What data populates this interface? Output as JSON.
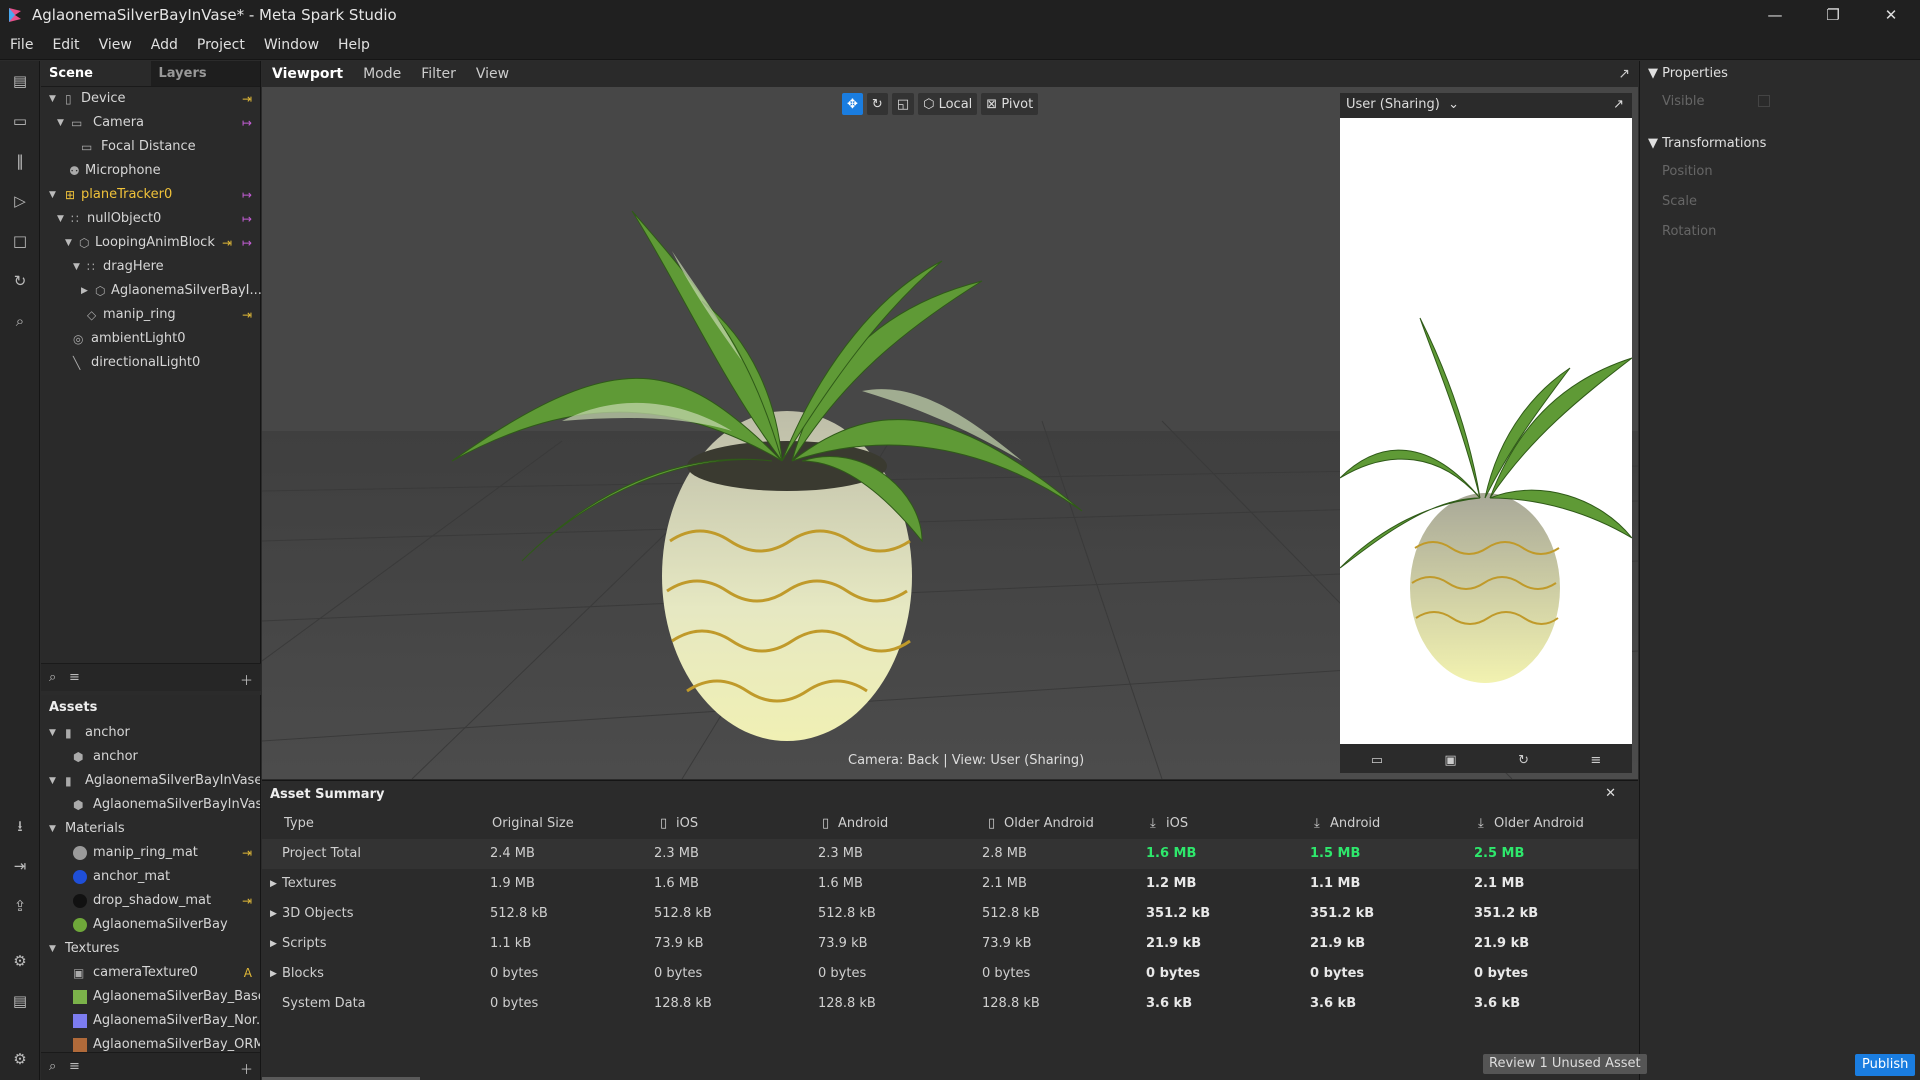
{
  "window": {
    "title": "AglaonemaSilverBayInVase* - Meta Spark Studio",
    "controls": [
      "minimize",
      "restore",
      "close"
    ]
  },
  "menu": [
    "File",
    "Edit",
    "View",
    "Add",
    "Project",
    "Window",
    "Help"
  ],
  "scene": {
    "tabs": [
      "Scene",
      "Layers"
    ],
    "items": [
      {
        "label": "Device",
        "icon": "device-icon"
      },
      {
        "label": "Camera",
        "icon": "camera-icon"
      },
      {
        "label": "Focal Distance",
        "icon": "focal-distance-icon"
      },
      {
        "label": "Microphone",
        "icon": "microphone-icon"
      },
      {
        "label": "planeTracker0",
        "icon": "plane-tracker-icon"
      },
      {
        "label": "nullObject0",
        "icon": "null-object-icon"
      },
      {
        "label": "LoopingAnimBlock",
        "icon": "block-icon"
      },
      {
        "label": "dragHere",
        "icon": "null-object-icon"
      },
      {
        "label": "AglaonemaSilverBayI...",
        "icon": "mesh-icon"
      },
      {
        "label": "manip_ring",
        "icon": "mesh-icon"
      },
      {
        "label": "ambientLight0",
        "icon": "ambient-light-icon"
      },
      {
        "label": "directionalLight0",
        "icon": "directional-light-icon"
      }
    ]
  },
  "assets": {
    "title": "Assets",
    "items": [
      {
        "label": "anchor",
        "icon": "file-icon"
      },
      {
        "label": "anchor",
        "icon": "mesh-icon"
      },
      {
        "label": "AglaonemaSilverBayInVase",
        "icon": "file-icon"
      },
      {
        "label": "AglaonemaSilverBayInVase",
        "icon": "mesh-icon"
      },
      {
        "label": "Materials",
        "icon": "folder"
      },
      {
        "label": "manip_ring_mat",
        "color": "#9a9a9a"
      },
      {
        "label": "anchor_mat",
        "color": "#1f4fd8"
      },
      {
        "label": "drop_shadow_mat",
        "color": "#111111"
      },
      {
        "label": "AglaonemaSilverBay",
        "color": "#6fa83a"
      },
      {
        "label": "Textures",
        "icon": "folder"
      },
      {
        "label": "cameraTexture0",
        "tag": "A"
      },
      {
        "label": "AglaonemaSilverBay_Base...",
        "color": "#7bb24a"
      },
      {
        "label": "AglaonemaSilverBay_Nor...",
        "color": "#7d7df0"
      },
      {
        "label": "AglaonemaSilverBay_ORM...",
        "color": "#b06a3a"
      }
    ]
  },
  "viewport": {
    "tabs": [
      "Viewport",
      "Mode",
      "Filter",
      "View"
    ],
    "toolbar": {
      "local": "Local",
      "pivot": "Pivot"
    },
    "camera_label": "Camera: Back | View: User (Sharing)",
    "preview_title": "User (Sharing)"
  },
  "properties": {
    "title": "Properties",
    "visible": "Visible",
    "transformations": "Transformations",
    "position": "Position",
    "scale": "Scale",
    "rotation": "Rotation"
  },
  "summary": {
    "title": "Asset Summary",
    "headers": [
      "Type",
      "Original Size",
      "iOS",
      "Android",
      "Older Android",
      "iOS",
      "Android",
      "Older Android"
    ],
    "rows": [
      {
        "type": "Project Total",
        "cells": [
          "2.4 MB",
          "2.3 MB",
          "2.3 MB",
          "2.8 MB",
          "1.6 MB",
          "1.5 MB",
          "2.5 MB"
        ]
      },
      {
        "type": "Textures",
        "cells": [
          "1.9 MB",
          "1.6 MB",
          "1.6 MB",
          "2.1 MB",
          "1.2 MB",
          "1.1 MB",
          "2.1 MB"
        ]
      },
      {
        "type": "3D Objects",
        "cells": [
          "512.8 kB",
          "512.8 kB",
          "512.8 kB",
          "512.8 kB",
          "351.2 kB",
          "351.2 kB",
          "351.2 kB"
        ]
      },
      {
        "type": "Scripts",
        "cells": [
          "1.1 kB",
          "73.9 kB",
          "73.9 kB",
          "73.9 kB",
          "21.9 kB",
          "21.9 kB",
          "21.9 kB"
        ]
      },
      {
        "type": "Blocks",
        "cells": [
          "0 bytes",
          "0 bytes",
          "0 bytes",
          "0 bytes",
          "0 bytes",
          "0 bytes",
          "0 bytes"
        ]
      },
      {
        "type": "System Data",
        "cells": [
          "0 bytes",
          "128.8 kB",
          "128.8 kB",
          "128.8 kB",
          "3.6 kB",
          "3.6 kB",
          "3.6 kB"
        ]
      }
    ],
    "review_button": "Review 1 Unused Asset"
  },
  "publish_button": "Publish"
}
